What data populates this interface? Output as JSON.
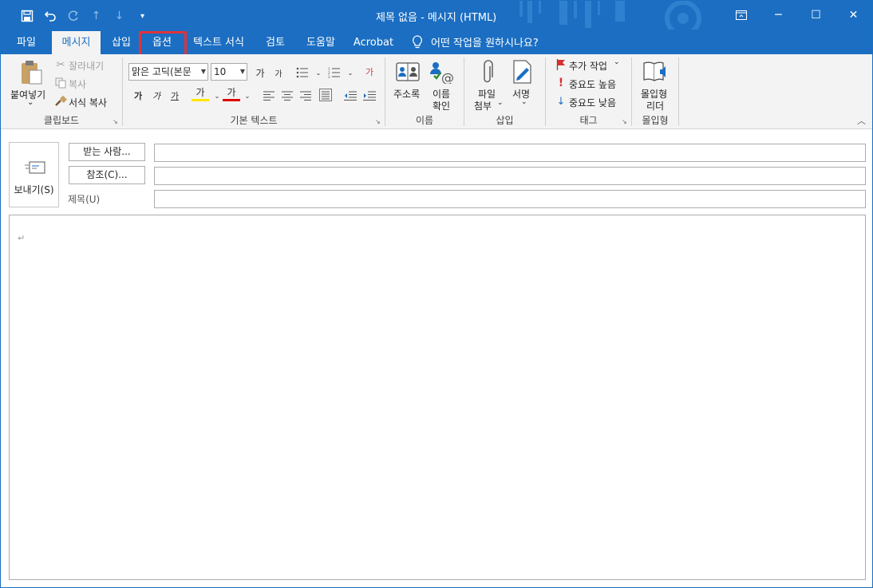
{
  "window": {
    "title": "제목 없음  -  메시지 (HTML)",
    "accent_color": "#1b6ec2",
    "highlight_color": "#e0333b",
    "controls": {
      "restore_icon": "ribbon-display-icon",
      "minimize": "─",
      "maximize": "☐",
      "close": "✕"
    }
  },
  "qat": {
    "save_icon": "save-icon",
    "undo_icon": "undo-icon",
    "redo_icon": "redo-icon",
    "up_icon": "previous-item-icon",
    "down_icon": "next-item-icon",
    "customize_icon": "customize-qat-icon"
  },
  "tabs": [
    {
      "label": "파일"
    },
    {
      "label": "메시지",
      "active": true
    },
    {
      "label": "삽입"
    },
    {
      "label": "옵션",
      "highlighted": true
    },
    {
      "label": "텍스트 서식"
    },
    {
      "label": "검토"
    },
    {
      "label": "도움말"
    },
    {
      "label": "Acrobat"
    }
  ],
  "tell_me": {
    "text": "어떤 작업을 원하시나요?",
    "icon": "lightbulb-icon"
  },
  "ribbon": {
    "clipboard": {
      "label": "클립보드",
      "paste": "붙여넣기",
      "paste_arrow": "⌄",
      "cut": "잘라내기",
      "copy": "복사",
      "format_painter": "서식 복사"
    },
    "basic_text": {
      "label": "기본 텍스트",
      "font_name": "맑은 고딕(본문",
      "font_size": "10",
      "grow_font": "가",
      "shrink_font": "가",
      "bold": "가",
      "italic": "가",
      "underline": "가",
      "highlight": "가",
      "font_color": "가",
      "clear_format": "가"
    },
    "names": {
      "label": "이름",
      "address_book": "주소록",
      "check_names_1": "이름",
      "check_names_2": "확인"
    },
    "insert": {
      "label": "삽입",
      "attach_1": "파일",
      "attach_2": "첨부",
      "signature": "서명"
    },
    "tags": {
      "label": "태그",
      "follow_up": "추가 작업",
      "high_importance": "중요도 높음",
      "low_importance": "중요도 낮음"
    },
    "immersive": {
      "label": "몰입형",
      "reader_1": "몰입형",
      "reader_2": "리더"
    }
  },
  "compose": {
    "send": "보내기(S)",
    "to_button": "받는 사람...",
    "cc_button": "참조(C)...",
    "subject_label": "제목(U)",
    "to_value": "",
    "cc_value": "",
    "subject_value": "",
    "body_mark": "↵"
  }
}
